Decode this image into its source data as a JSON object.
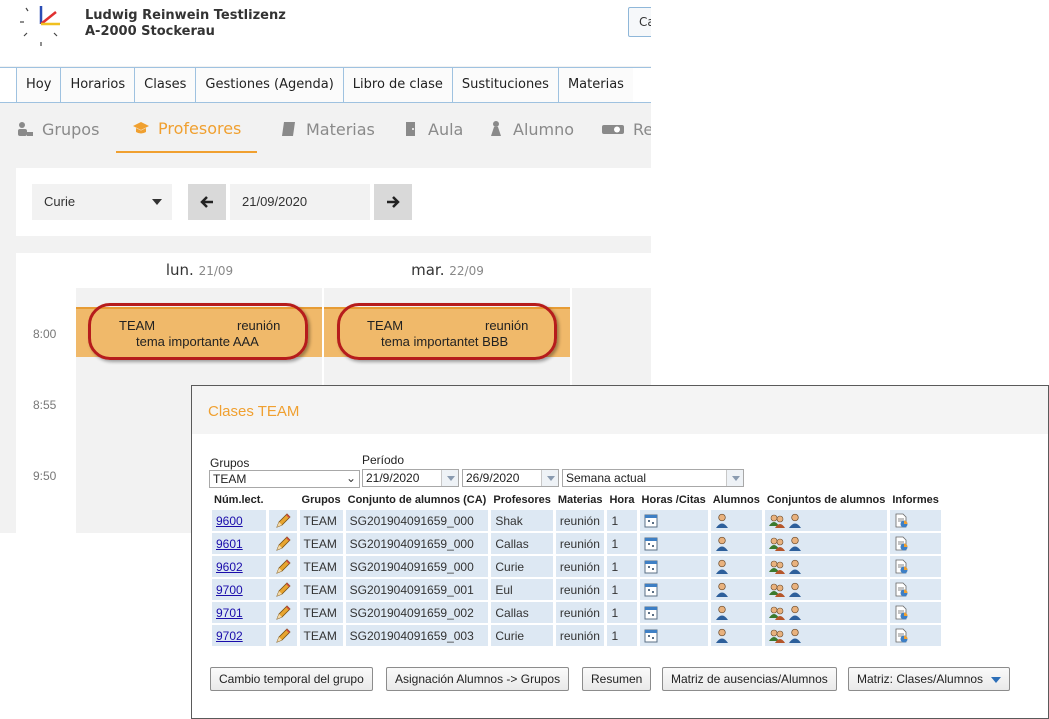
{
  "header": {
    "school_line1": "Ludwig Reinwein Testlizenz",
    "school_line2": "A-2000 Stockerau",
    "right_button": "Ca"
  },
  "menu": [
    "Hoy",
    "Horarios",
    "Clases",
    "Gestiones (Agenda)",
    "Libro de clase",
    "Sustituciones",
    "Materias"
  ],
  "tabs": [
    {
      "label": "Grupos",
      "icon": "group-icon"
    },
    {
      "label": "Profesores",
      "icon": "graduation-cap-icon",
      "active": true
    },
    {
      "label": "Materias",
      "icon": "book-icon"
    },
    {
      "label": "Aula",
      "icon": "door-icon"
    },
    {
      "label": "Alumno",
      "icon": "student-icon"
    },
    {
      "label": "Re",
      "icon": "projector-icon"
    }
  ],
  "date_bar": {
    "teacher": "Curie",
    "date": "21/09/2020"
  },
  "calendar": {
    "days": [
      {
        "name": "lun.",
        "date": "21/09"
      },
      {
        "name": "mar.",
        "date": "22/09"
      }
    ],
    "times": [
      "8:00",
      "8:55",
      "9:50"
    ],
    "lessons": [
      {
        "group": "TEAM",
        "subject": "reunión",
        "topic": "tema importante AAA"
      },
      {
        "group": "TEAM",
        "subject": "reunión",
        "topic": "tema importantet BBB"
      }
    ]
  },
  "popup": {
    "title": "Clases TEAM",
    "grupos_label": "Grupos",
    "grupos_value": "TEAM",
    "periodo_label": "Período",
    "date_from": "21/9/2020",
    "date_to": "26/9/2020",
    "period_mode": "Semana actual",
    "columns": [
      "Núm.lect.",
      "",
      "Grupos",
      "Conjunto de alumnos (CA)",
      "Profesores",
      "Materias",
      "Hora",
      "Horas /Citas",
      "Alumnos",
      "Conjuntos de alumnos",
      "Informes"
    ],
    "rows": [
      {
        "num": "9600",
        "grupo": "TEAM",
        "ca": "SG201904091659_000",
        "profesor": "Shak",
        "materia": "reunión",
        "hora": "1"
      },
      {
        "num": "9601",
        "grupo": "TEAM",
        "ca": "SG201904091659_000",
        "profesor": "Callas",
        "materia": "reunión",
        "hora": "1"
      },
      {
        "num": "9602",
        "grupo": "TEAM",
        "ca": "SG201904091659_000",
        "profesor": "Curie",
        "materia": "reunión",
        "hora": "1"
      },
      {
        "num": "9700",
        "grupo": "TEAM",
        "ca": "SG201904091659_001",
        "profesor": "Eul",
        "materia": "reunión",
        "hora": "1"
      },
      {
        "num": "9701",
        "grupo": "TEAM",
        "ca": "SG201904091659_002",
        "profesor": "Callas",
        "materia": "reunión",
        "hora": "1"
      },
      {
        "num": "9702",
        "grupo": "TEAM",
        "ca": "SG201904091659_003",
        "profesor": "Curie",
        "materia": "reunión",
        "hora": "1"
      }
    ],
    "buttons": {
      "cambio": "Cambio temporal del grupo",
      "asignacion": "Asignación Alumnos -> Grupos",
      "resumen": "Resumen",
      "matriz_ausencias": "Matriz de ausencias/Alumnos",
      "matriz_clases": "Matriz: Clases/Alumnos"
    }
  },
  "colors": {
    "accent": "#f0a030",
    "lesson_fill": "#f0b96a",
    "highlight_oval": "#b61c1c",
    "row_fill": "#dde8f3",
    "menu_border": "#9fc2e0"
  }
}
